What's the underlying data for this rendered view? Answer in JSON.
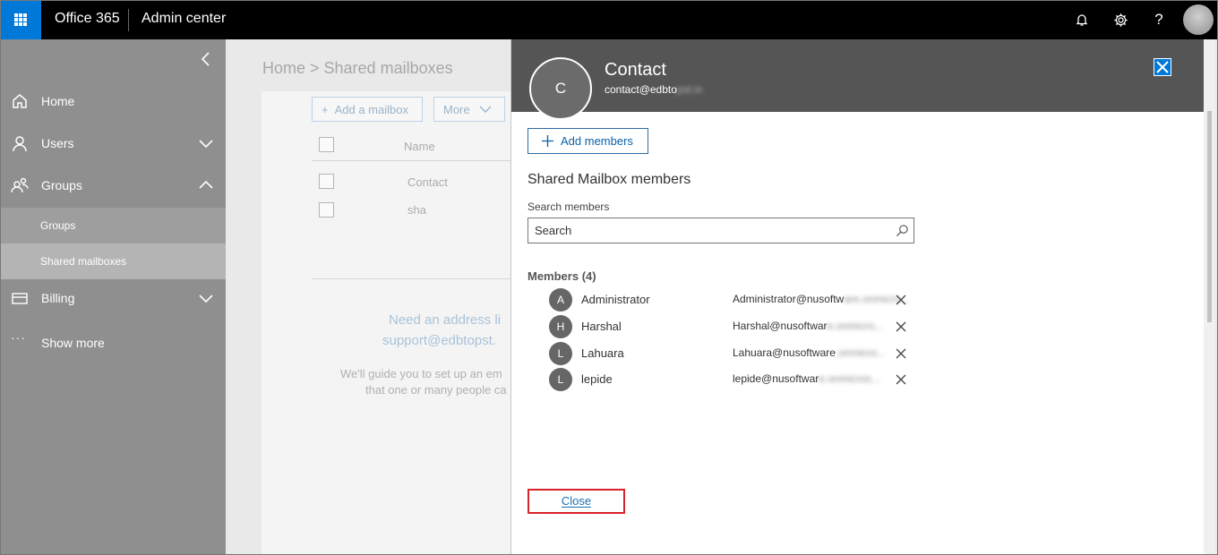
{
  "topbar": {
    "brand": "Office 365",
    "app_title": "Admin center",
    "icons": [
      "apps-waffle-icon",
      "bell-icon",
      "gear-icon",
      "help-icon",
      "user-avatar"
    ],
    "help_glyph": "?"
  },
  "sidebar": {
    "items": [
      {
        "label": "Home",
        "icon": "home-icon"
      },
      {
        "label": "Users",
        "icon": "users-icon",
        "expandable": true
      },
      {
        "label": "Groups",
        "icon": "groups-icon",
        "expanded": true
      },
      {
        "label": "Billing",
        "icon": "billing-icon",
        "expandable": true
      },
      {
        "label": "Show more",
        "icon": "more-icon"
      }
    ],
    "subitems": [
      {
        "label": "Groups"
      },
      {
        "label": "Shared mailboxes",
        "active": true
      }
    ],
    "more_glyph": "···"
  },
  "main": {
    "breadcrumb": "Home > Shared mailboxes",
    "toolbar": {
      "add_label": "Add a mailbox",
      "more_label": "More"
    },
    "table": {
      "column": "Name",
      "rows": [
        "Contact",
        "sha"
      ]
    },
    "empty": {
      "title_1": "Need an address li",
      "title_2": "support@edbtopst.",
      "sub_1": "We'll guide you to set up an em",
      "sub_2": "that one or many people ca"
    }
  },
  "panel": {
    "avatar_initial": "C",
    "title": "Contact",
    "email_visible": "contact@edbto",
    "email_blurred": "pst.in",
    "add_members_label": "Add members",
    "section_title": "Shared Mailbox members",
    "search_label": "Search members",
    "search_placeholder": "Search",
    "members_heading": "Members (4)",
    "members": [
      {
        "initial": "A",
        "name": "Administrator",
        "email_visible": "Administrator@nusoftw",
        "email_blurred": "are.onmicro..."
      },
      {
        "initial": "H",
        "name": "Harshal",
        "email_visible": "Harshal@nusoftwar",
        "email_blurred": "e.onmicro..."
      },
      {
        "initial": "L",
        "name": "Lahuara",
        "email_visible": "Lahuara@nusoftware",
        "email_blurred": ".onmicro..."
      },
      {
        "initial": "L",
        "name": "lepide",
        "email_visible": "lepide@nusoftwar",
        "email_blurred": "e.onmicros..."
      }
    ],
    "close_label": "Close"
  },
  "colors": {
    "accent": "#0078d7",
    "topbar": "#000000",
    "sidebar": "#8f8f8f",
    "panel_header": "#555555",
    "highlight_border": "#d8232a"
  }
}
